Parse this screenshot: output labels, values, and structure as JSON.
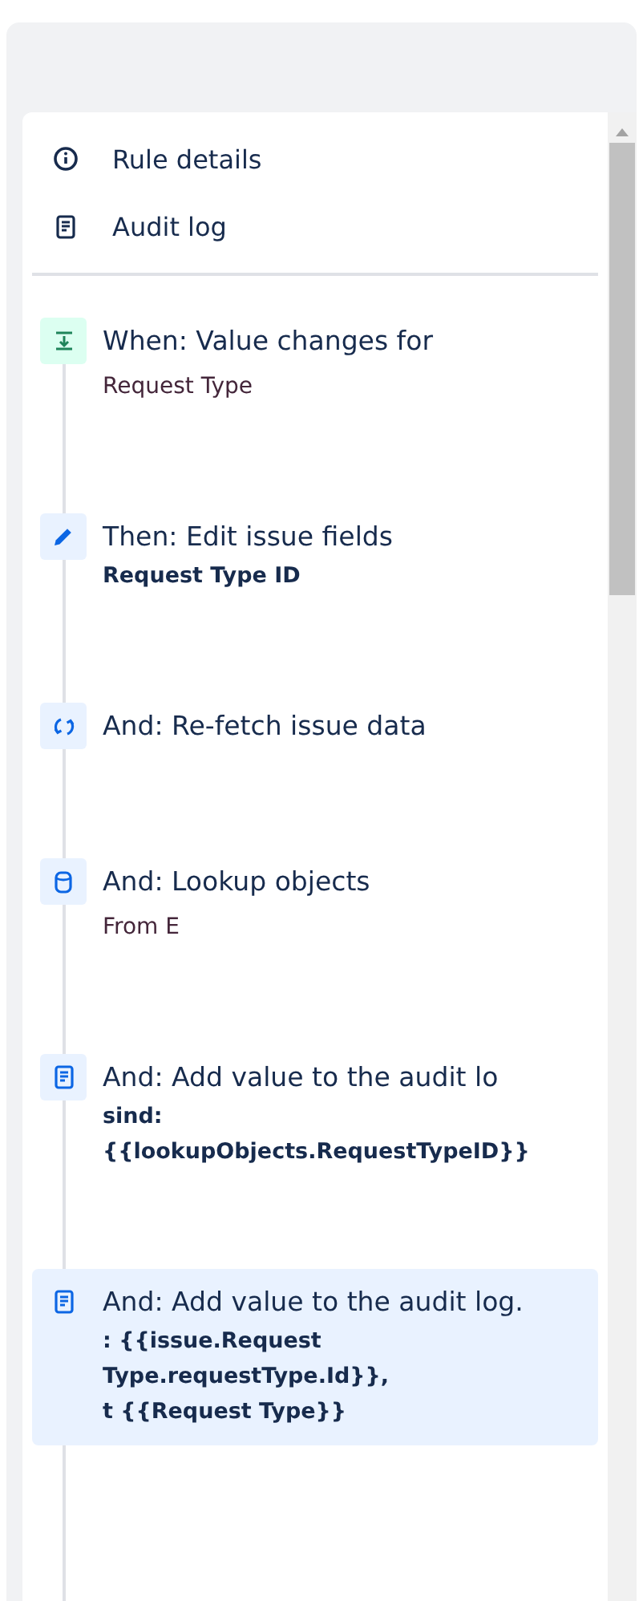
{
  "menu": [
    {
      "label": "Rule details",
      "kind": "info"
    },
    {
      "label": "Audit log",
      "kind": "log"
    }
  ],
  "steps": [
    {
      "kind": "trigger",
      "title": "When: Value changes for",
      "detail": [
        "Request Type"
      ],
      "detail_bold": false,
      "selected": false
    },
    {
      "kind": "edit",
      "title": "Then: Edit issue fields",
      "detail": [
        "Request Type ID"
      ],
      "detail_bold": true,
      "selected": false
    },
    {
      "kind": "refresh",
      "title": "And: Re-fetch issue data",
      "selected": false
    },
    {
      "kind": "lookup",
      "title": "And: Lookup objects",
      "detail": [
        "From E"
      ],
      "detail_bold": false,
      "selected": false
    },
    {
      "kind": "log",
      "title": "And: Add value to the audit lo",
      "detail": [
        "sind:",
        "{{lookupObjects.RequestTypeID}}"
      ],
      "detail_bold": true,
      "selected": false
    },
    {
      "kind": "log",
      "title": "And: Add value to the audit log.",
      "detail": [
        ": {{issue.Request",
        "Type.requestType.Id}},",
        "t {{Request Type}}"
      ],
      "detail_bold": true,
      "selected": true
    }
  ]
}
